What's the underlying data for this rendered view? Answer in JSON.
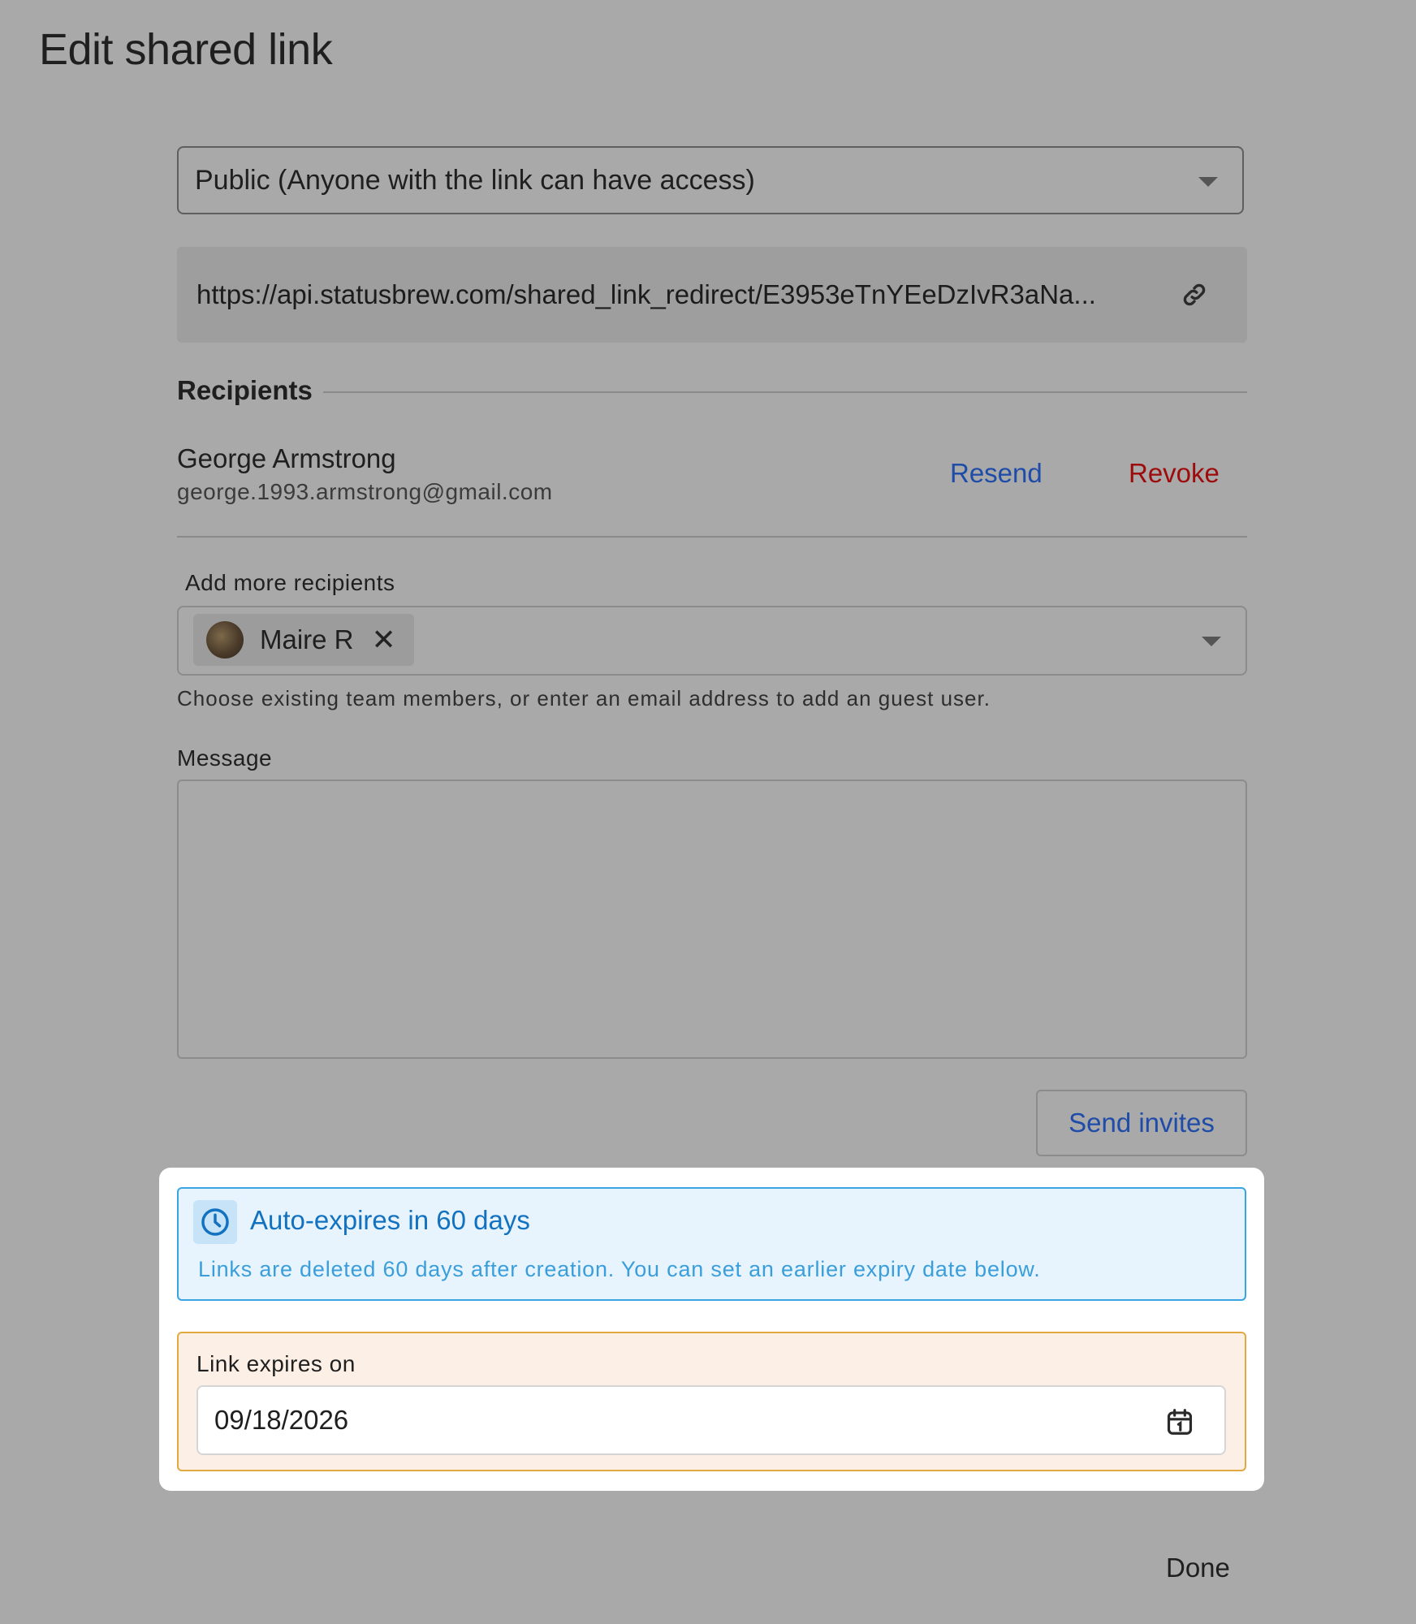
{
  "dialog": {
    "title": "Edit shared link",
    "done_label": "Done"
  },
  "access": {
    "selected": "Public (Anyone with the link can have access)"
  },
  "link": {
    "url": "https://api.statusbrew.com/shared_link_redirect/E3953eTnYEeDzIvR3aNa..."
  },
  "recipients": {
    "heading": "Recipients",
    "items": [
      {
        "name": "George Armstrong",
        "email": "george.1993.armstrong@gmail.com",
        "resend_label": "Resend",
        "revoke_label": "Revoke"
      }
    ]
  },
  "add_recipients": {
    "label": "Add more recipients",
    "chips": [
      {
        "label": "Maire R"
      }
    ],
    "hint": "Choose existing team members, or enter an email address to add an guest user."
  },
  "message": {
    "label": "Message",
    "value": ""
  },
  "send_invites_label": "Send invites",
  "expiry_info": {
    "title": "Auto-expires in 60 days",
    "text": "Links are deleted 60 days after creation. You can set an earlier expiry date below."
  },
  "expiry_date": {
    "label": "Link expires on",
    "value": "09/18/2026"
  },
  "icons": {
    "link": "link-icon",
    "clock": "clock-icon",
    "calendar": "calendar-icon",
    "close": "close-icon",
    "dropdown": "chevron-down-icon"
  },
  "colors": {
    "link_blue": "#1f4ca8",
    "danger_red": "#9e0b0b",
    "info_blue": "#1272c0",
    "info_border": "#3aa3e2",
    "warning_border": "#e3a941"
  }
}
